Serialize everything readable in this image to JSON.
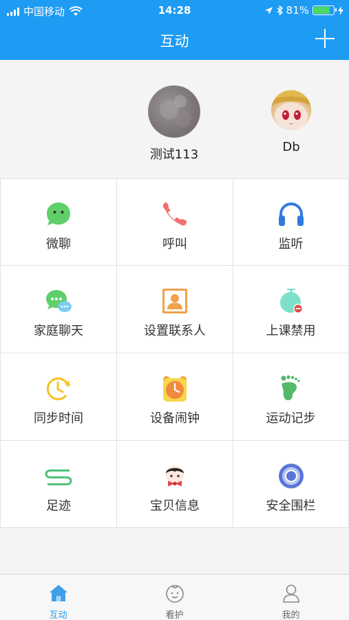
{
  "status_bar": {
    "carrier": "中国移动",
    "time": "14:28",
    "battery": "81%",
    "battery_level": 0.81
  },
  "nav": {
    "title": "互动",
    "add_icon": "plus-icon"
  },
  "devices": [
    {
      "name": "测试113",
      "avatar": "gray-photo-avatar"
    },
    {
      "name": "Db",
      "avatar": "anime-girl-avatar"
    }
  ],
  "features": [
    {
      "label": "微聊",
      "icon": "chat-face-icon",
      "color": "#5fcf6a"
    },
    {
      "label": "呼叫",
      "icon": "phone-icon",
      "color": "#ef6f6c"
    },
    {
      "label": "监听",
      "icon": "headphones-icon",
      "color": "#2f7be0"
    },
    {
      "label": "家庭聊天",
      "icon": "group-chat-icon",
      "color": "#5fcf6a"
    },
    {
      "label": "设置联系人",
      "icon": "contact-card-icon",
      "color": "#f2a14a"
    },
    {
      "label": "上课禁用",
      "icon": "class-ban-icon",
      "color": "#7ee0c9"
    },
    {
      "label": "同步时间",
      "icon": "clock-sync-icon",
      "color": "#f7c32a"
    },
    {
      "label": "设备闹钟",
      "icon": "alarm-clock-icon",
      "color": "#f0a23a"
    },
    {
      "label": "运动记步",
      "icon": "footprint-icon",
      "color": "#55b96a"
    },
    {
      "label": "足迹",
      "icon": "track-route-icon",
      "color": "#4bbf74"
    },
    {
      "label": "宝贝信息",
      "icon": "baby-info-icon",
      "color": "#e04848"
    },
    {
      "label": "安全围栏",
      "icon": "geofence-icon",
      "color": "#5b74d9"
    }
  ],
  "tabbar": {
    "active_color": "#1e9bf3",
    "items": [
      {
        "label": "互动",
        "icon": "home-icon",
        "active": true
      },
      {
        "label": "看护",
        "icon": "baby-face-icon",
        "active": false
      },
      {
        "label": "我的",
        "icon": "person-icon",
        "active": false
      }
    ]
  }
}
